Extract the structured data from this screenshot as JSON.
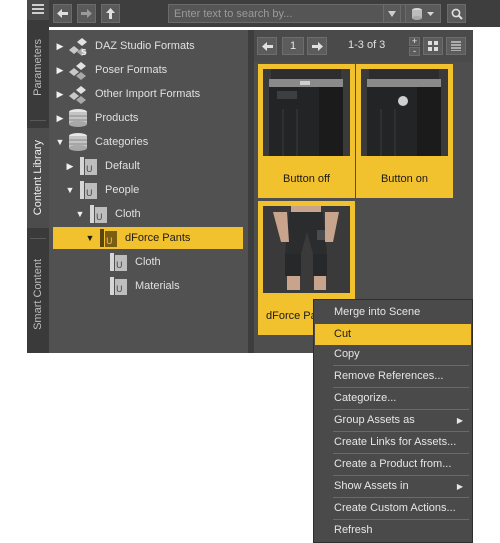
{
  "tabs": {
    "parameters": "Parameters",
    "content_library": "Content Library",
    "smart_content": "Smart Content"
  },
  "toolbar": {
    "search_placeholder": "Enter text to search by..."
  },
  "tree": {
    "items": [
      {
        "label": "DAZ Studio Formats",
        "expanded": false,
        "icon": "daz-format-icon"
      },
      {
        "label": "Poser Formats",
        "expanded": false,
        "icon": "poser-format-icon"
      },
      {
        "label": "Other Import Formats",
        "expanded": false,
        "icon": "import-format-icon"
      },
      {
        "label": "Products",
        "expanded": false,
        "icon": "products-icon"
      },
      {
        "label": "Categories",
        "expanded": true,
        "icon": "categories-icon"
      },
      {
        "label": "Default",
        "expanded": false,
        "icon": "category-folder-icon"
      },
      {
        "label": "People",
        "expanded": true,
        "icon": "category-folder-icon"
      },
      {
        "label": "Cloth",
        "expanded": true,
        "icon": "category-folder-icon"
      },
      {
        "label": "dForce Pants",
        "expanded": true,
        "selected": true,
        "icon": "category-folder-icon"
      },
      {
        "label": "Cloth",
        "expanded": false,
        "icon": "category-folder-icon"
      },
      {
        "label": "Materials",
        "expanded": false,
        "icon": "category-folder-icon"
      }
    ]
  },
  "pager": {
    "page": "1",
    "range": "1-3 of 3",
    "zoom_in": "+",
    "zoom_out": "-"
  },
  "cards": [
    {
      "label": "Button off"
    },
    {
      "label": "Button on"
    },
    {
      "label": "dForce Pa"
    }
  ],
  "context_menu": {
    "items": [
      {
        "label": "Merge into Scene"
      },
      {
        "label": "Cut",
        "highlighted": true
      },
      {
        "label": "Copy"
      },
      {
        "label": "Remove References..."
      },
      {
        "label": "Categorize..."
      },
      {
        "label": "Group Assets as",
        "submenu": true
      },
      {
        "label": "Create Links for Assets..."
      },
      {
        "label": "Create a Product from..."
      },
      {
        "label": "Show Assets in",
        "submenu": true
      },
      {
        "label": "Create Custom Actions..."
      },
      {
        "label": "Refresh"
      }
    ]
  },
  "colors": {
    "accent": "#f2c12e",
    "panel": "#515151",
    "menu": "#4a4a4a"
  }
}
